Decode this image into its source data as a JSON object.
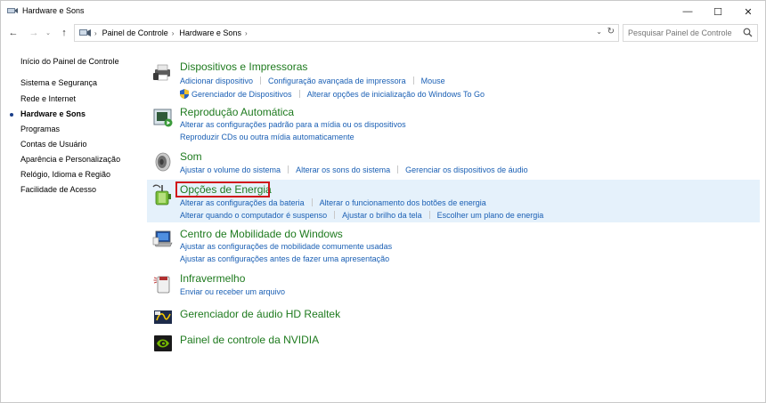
{
  "window": {
    "title": "Hardware e Sons",
    "minimize": "—",
    "maximize": "☐",
    "close": "✕"
  },
  "nav": {
    "back": "←",
    "forward": "→",
    "recent": "⌄",
    "up": "↑"
  },
  "address": {
    "crumbs": [
      "Painel de Controle",
      "Hardware e Sons"
    ],
    "separator": "›",
    "dropdown": "⌄",
    "refresh": "↻"
  },
  "search": {
    "placeholder": "Pesquisar Painel de Controle"
  },
  "sidebar": {
    "items": [
      {
        "label": "Início do Painel de Controle"
      },
      {
        "label": "Sistema e Segurança"
      },
      {
        "label": "Rede e Internet"
      },
      {
        "label": "Hardware e Sons",
        "active": true
      },
      {
        "label": "Programas"
      },
      {
        "label": "Contas de Usuário"
      },
      {
        "label": "Aparência e Personalização"
      },
      {
        "label": "Relógio, Idioma e Região"
      },
      {
        "label": "Facilidade de Acesso"
      }
    ]
  },
  "categories": [
    {
      "title": "Dispositivos e Impressoras",
      "icon": "printer-icon",
      "link_rows": [
        [
          "Adicionar dispositivo",
          "Configuração avançada de impressora",
          "Mouse"
        ],
        [
          "Gerenciador de Dispositivos",
          "Alterar opções de inicialização do Windows To Go"
        ]
      ]
    },
    {
      "title": "Reprodução Automática",
      "icon": "autoplay-icon",
      "link_rows": [
        [
          "Alterar as configurações padrão para a mídia ou os dispositivos"
        ],
        [
          "Reproduzir CDs ou outra mídia automaticamente"
        ]
      ]
    },
    {
      "title": "Som",
      "icon": "speaker-icon",
      "link_rows": [
        [
          "Ajustar o volume do sistema",
          "Alterar os sons do sistema",
          "Gerenciar os dispositivos de áudio"
        ]
      ]
    },
    {
      "title": "Opções de Energia",
      "icon": "power-options-icon",
      "highlighted": true,
      "link_rows": [
        [
          "Alterar as configurações da bateria",
          "Alterar o funcionamento dos botões de energia"
        ],
        [
          "Alterar quando o computador é suspenso",
          "Ajustar o brilho da tela",
          "Escolher um plano de energia"
        ]
      ]
    },
    {
      "title": "Centro de Mobilidade do Windows",
      "icon": "mobility-center-icon",
      "link_rows": [
        [
          "Ajustar as configurações de mobilidade comumente usadas"
        ],
        [
          "Ajustar as configurações antes de fazer uma apresentação"
        ]
      ]
    },
    {
      "title": "Infravermelho",
      "icon": "infrared-icon",
      "link_rows": [
        [
          "Enviar ou receber um arquivo"
        ]
      ]
    },
    {
      "title": "Gerenciador de áudio HD Realtek",
      "icon": "realtek-audio-icon",
      "link_rows": []
    },
    {
      "title": "Painel de controle da NVIDIA",
      "icon": "nvidia-icon",
      "link_rows": []
    }
  ],
  "colors": {
    "category_title": "#1e7a1e",
    "link": "#1a5fb4",
    "highlight_bg": "#e5f1fb",
    "annotation_box": "#d0141a"
  }
}
